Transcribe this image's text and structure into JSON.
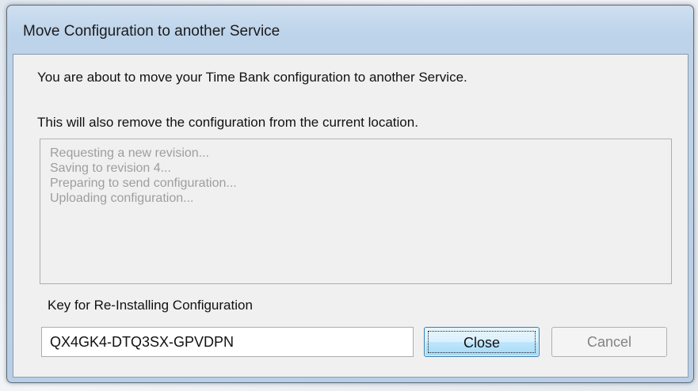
{
  "window": {
    "title": "Move Configuration to another Service"
  },
  "dialog": {
    "message_line_1": "You are about to move your Time Bank configuration to another Service.",
    "message_line_2": "This will also remove the configuration from the current location.",
    "log_lines": [
      "Requesting a new revision...",
      "Saving to revision 4...",
      "Preparing to send configuration...",
      "Uploading configuration..."
    ],
    "key_label": "Key for Re-Installing Configuration",
    "key_value": "QX4GK4-DTQ3SX-GPVDPN",
    "close_label": "Close",
    "cancel_label": "Cancel"
  }
}
